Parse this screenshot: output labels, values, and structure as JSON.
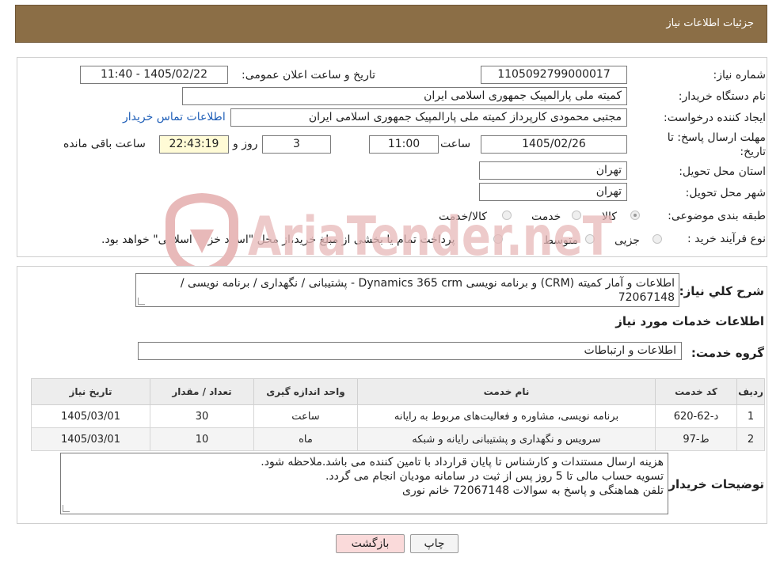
{
  "header": {
    "title": "جزئیات اطلاعات نیاز"
  },
  "form": {
    "need_number_label": "شماره نیاز:",
    "need_number": "1105092799000017",
    "announce_label": "تاریخ و ساعت اعلان عمومی:",
    "announce_value": "1405/02/22 - 11:40",
    "buyer_org_label": "نام دستگاه خریدار:",
    "buyer_org": "کمیته ملی پارالمپیک جمهوری اسلامی ایران",
    "creator_label": "ایجاد کننده درخواست:",
    "creator": "مجتبی محمودی کارپرداز کمیته ملی پارالمپیک جمهوری اسلامی ایران",
    "contact_link": "اطلاعات تماس خریدار",
    "deadline_label_1": "مهلت ارسال پاسخ: تا",
    "deadline_label_2": "تاریخ:",
    "deadline_date": "1405/02/26",
    "time_label": "ساعت",
    "deadline_time": "11:00",
    "days_value": "3",
    "days_label": "روز و",
    "remaining_time": "22:43:19",
    "remaining_label": "ساعت باقی مانده",
    "province_label": "استان محل تحویل:",
    "province": "تهران",
    "city_label": "شهر محل تحویل:",
    "city": "تهران",
    "category_label": "طبقه بندی موضوعی:",
    "category_options": [
      "کالا",
      "خدمت",
      "کالا/خدمت"
    ],
    "process_label": "نوع فرآیند خرید :",
    "process_options": [
      "جزیی",
      "متوسط"
    ],
    "process_note": "پرداخت تمام یا بخشی از مبلغ خرید،از محل \"اسناد خزانه اسلامی\" خواهد بود."
  },
  "summary": {
    "label": "شرح کلي نیاز:",
    "text": "اطلاعات و آمار کمیته (CRM) و برنامه نویسی Dynamics 365 crm - پشتیبانی / نگهداری / برنامه نویسی / 72067148"
  },
  "services": {
    "section_title": "اطلاعات خدمات مورد نیاز",
    "group_label": "گروه خدمت:",
    "group_value": "اطلاعات و ارتباطات",
    "columns": [
      "ردیف",
      "کد خدمت",
      "نام خدمت",
      "واحد اندازه گیری",
      "تعداد / مقدار",
      "تاریخ نیاز"
    ],
    "rows": [
      [
        "1",
        "د-62-620",
        "برنامه نویسی، مشاوره و فعالیت‌های مربوط به رایانه",
        "ساعت",
        "30",
        "1405/03/01"
      ],
      [
        "2",
        "ط-97",
        "سرویس و نگهداری و پشتیبانی رایانه و شبکه",
        "ماه",
        "10",
        "1405/03/01"
      ]
    ]
  },
  "buyer_notes": {
    "label": "توضیحات خریدار:",
    "lines": [
      "هزینه ارسال مستندات و کارشناس تا پایان قرارداد با تامین کننده می باشد.ملاحظه شود.",
      "تسویه حساب مالی تا 5 روز پس از ثبت در سامانه مودیان انجام می گردد.",
      "تلفن هماهنگی و پاسخ به سوالات 72067148 خانم نوری"
    ]
  },
  "buttons": {
    "print": "چاپ",
    "back": "بازگشت"
  },
  "watermark": {
    "text": "AriaTender.neT"
  },
  "colors": {
    "header_bg": "#8b6e46",
    "link": "#1f5fb8",
    "back_button_bg": "#fadada",
    "watermark": "#e8b9b9"
  }
}
